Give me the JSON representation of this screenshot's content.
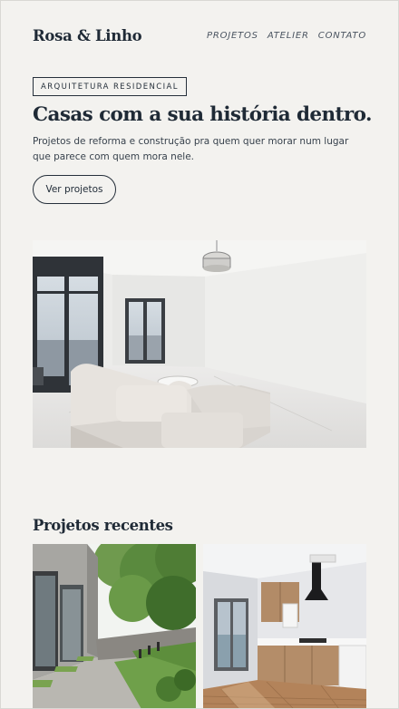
{
  "brand": {
    "logo": "Rosa & Linho"
  },
  "nav": {
    "items": [
      "PROJETOS",
      "ATELIER",
      "CONTATO"
    ]
  },
  "hero": {
    "eyebrow": "ARQUITETURA RESIDENCIAL",
    "title": "Casas com a sua história dentro.",
    "lede": "Projetos de reforma e construção pra quem quer morar num lugar que parece com quem mora nele.",
    "cta": "Ver projetos"
  },
  "recent": {
    "title": "Projetos recentes"
  },
  "colors": {
    "background": "#f3f2ef",
    "ink": "#1f2a36",
    "text": "#38424d"
  },
  "icons": []
}
